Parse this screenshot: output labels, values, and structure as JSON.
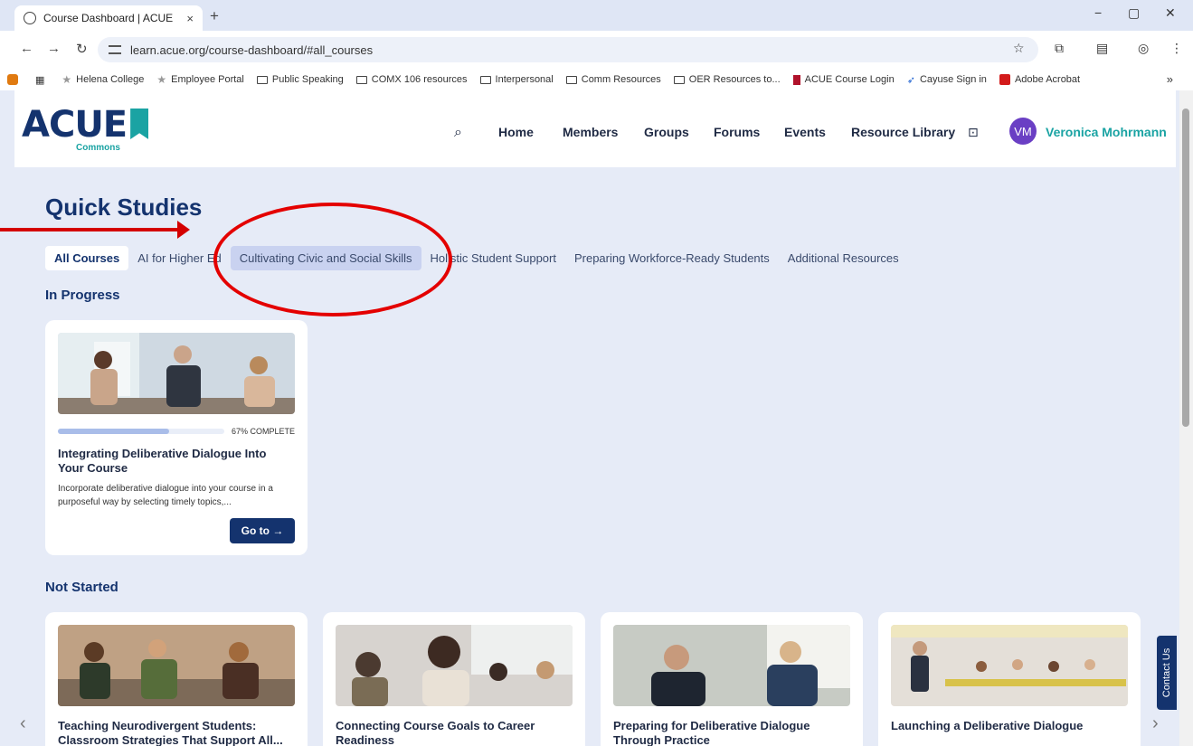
{
  "browser": {
    "tab_title": "Course Dashboard | ACUE",
    "tab_close": "×",
    "new_tab": "+",
    "url": "learn.acue.org/course-dashboard/#all_courses",
    "window_controls": [
      "−",
      "▢",
      "✕"
    ],
    "bookmarks": [
      {
        "label": "Helena College",
        "icon": "star-icon"
      },
      {
        "label": "Employee Portal",
        "icon": "star-icon"
      },
      {
        "label": "Public Speaking",
        "icon": "folder-icon"
      },
      {
        "label": "COMX 106 resources",
        "icon": "folder-icon"
      },
      {
        "label": "Interpersonal",
        "icon": "folder-icon"
      },
      {
        "label": "Comm Resources",
        "icon": "folder-icon"
      },
      {
        "label": "OER Resources to...",
        "icon": "folder-icon"
      },
      {
        "label": "ACUE Course Login",
        "icon": "bookmark-icon"
      },
      {
        "label": "Cayuse Sign in",
        "icon": "cayuse-icon"
      },
      {
        "label": "Adobe Acrobat",
        "icon": "acrobat-icon"
      }
    ],
    "bookmarks_more": "»"
  },
  "site": {
    "logo_main": "ACUE",
    "logo_sub": "Commons",
    "nav": [
      "Home",
      "Members",
      "Groups",
      "Forums",
      "Events",
      "Resource Library"
    ],
    "user_initials": "VM",
    "user_name": "Veronica Mohrmann"
  },
  "main": {
    "title": "Quick Studies",
    "filters": [
      "All Courses",
      "AI for Higher Ed",
      "Cultivating Civic and Social Skills",
      "Holistic Student Support",
      "Preparing Workforce-Ready Students",
      "Additional Resources"
    ],
    "in_progress_label": "In Progress",
    "in_progress": {
      "progress_percent": 67,
      "progress_label": "67% COMPLETE",
      "title": "Integrating Deliberative Dialogue Into Your Course",
      "description": "Incorporate deliberative dialogue into your course in a purposeful way by selecting timely topics,...",
      "button": "Go to →"
    },
    "not_started_label": "Not Started",
    "not_started": [
      {
        "title": "Teaching Neurodivergent Students: Classroom Strategies That Support All..."
      },
      {
        "title": "Connecting Course Goals to Career Readiness"
      },
      {
        "title": "Preparing for Deliberative Dialogue Through Practice"
      },
      {
        "title": "Launching a Deliberative Dialogue"
      }
    ],
    "contact_us": "Contact Us"
  },
  "colors": {
    "brand_navy": "#14336e",
    "brand_teal": "#1aa3a3",
    "page_bg": "#e6ebf7",
    "annotation_red": "#e40000"
  }
}
